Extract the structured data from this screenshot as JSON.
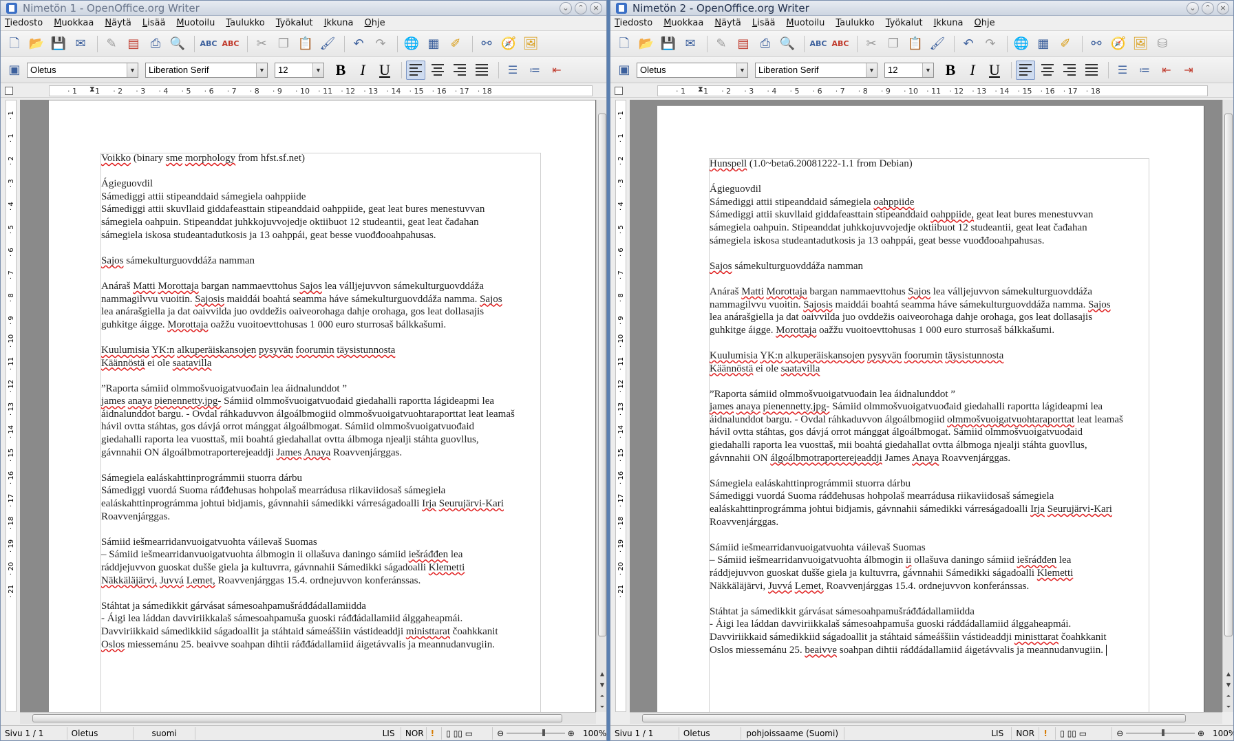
{
  "menu": [
    "Tiedosto",
    "Muokkaa",
    "Näytä",
    "Lisää",
    "Muotoilu",
    "Taulukko",
    "Työkalut",
    "Ikkuna",
    "Ohje"
  ],
  "format": {
    "style": "Oletus",
    "font": "Liberation Serif",
    "size": "12"
  },
  "icons": [
    "new-icon",
    "open-folder-icon",
    "save-icon",
    "email-icon",
    "edit-file-icon",
    "export-pdf-icon",
    "print-icon",
    "print-preview-icon",
    "spellcheck-icon",
    "autospell-icon",
    "cut-icon",
    "copy-icon",
    "paste-icon",
    "format-paintbrush-icon",
    "undo-icon",
    "redo-icon",
    "hyperlink-icon",
    "table-icon",
    "draw-functions-icon",
    "find-binoculars-icon",
    "navigator-icon",
    "gallery-icon",
    "datasources-icon"
  ],
  "ruler_ticks": [
    "1",
    "1",
    "2",
    "3",
    "4",
    "5",
    "6",
    "7",
    "8",
    "9",
    "10",
    "11",
    "12",
    "13",
    "14",
    "15",
    "16",
    "17",
    "18"
  ],
  "vruler_ticks": [
    "1",
    "1",
    "2",
    "3",
    "4",
    "5",
    "6",
    "7",
    "8",
    "9",
    "10",
    "11",
    "12",
    "13",
    "14",
    "15",
    "16",
    "17",
    "18",
    "19",
    "20",
    "21"
  ],
  "window1": {
    "title": "Nimetön 1 - OpenOffice.org Writer",
    "doc": [
      "Voikko (binary sme morphology from hfst.sf.net)",
      "",
      "Ágieguovdil",
      "Sámediggi attii stipeanddaid sámegiela oahppiide",
      "Sámediggi attii skuvllaid giddafeasttain stipeanddaid oahppiide, geat leat bures menestuvvan",
      "sámegiela oahpuin. Stipeanddat juhkkojuvvojedje oktiibuot 12 studeantii, geat leat čađahan",
      "sámegiela iskosa studeantadutkosis ja 13 oahppái, geat besse vuođđooahpahusas.",
      "",
      "Sajos sámekulturguovddáža namman",
      "",
      "Anáraš Matti Morottaja bargan nammaevttohus Sajos lea válljejuvvon sámekulturguovddáža",
      "nammagilvvu vuoitin. Sajosis maiddái boahtá seamma háve sámekulturguovddáža namma. Sajos",
      "lea anárašgiella ja dat oaivvilda juo ovddežis oaiveorohaga dahje orohaga, gos leat dollasajis",
      "guhkitge áigge. Morottaja oažžu vuoitoevttohusas 1 000 euro sturrosaš bálkkašumi.",
      "",
      "Kuulumisia YK:n alkuperäiskansojen pysyvän foorumin täysistunnosta",
      "Käännöstä ei ole saatavilla",
      "",
      "”Raporta sámiid olmmošvuoigatvuođain lea áidnalunddot ”",
      "james anaya pienennetty.jpg- Sámiid olmmošvuoigatvuođaid giedahalli raportta lágideapmi lea",
      "áidnalunddot bargu. - Ovdal ráhkaduvvon álgoálbmogiid olmmošvuoigatvuohtaraporttat leat leamaš",
      "hávil ovtta stáhtas, gos dávjá orrot mánggat álgoálbmogat. Sámiid olmmošvuoigatvuođaid",
      "giedahalli raporta lea vuosttaš, mii boahtá giedahallat ovtta álbmoga njealji stáhta guovllus,",
      "gávnnahii ON álgoálbmotraporterejeaddji James Anaya Roavvenjárggas.",
      "",
      "Sámegiela ealáskahttinprográmmii stuorra dárbu",
      "Sámediggi vuordá Suoma ráđđehusas hohpolaš mearrádusa riikaviidosaš sámegiela",
      "ealáskahttinprográmma johtui bidjamis, gávnnahii sámedikki várreságadoalli Irja Seurujärvi-Kari",
      "Roavvenjárggas.",
      "",
      "Sámiid iešmearridanvuoigatvuohta váilevaš Suomas",
      "– Sámiid iešmearridanvuoigatvuohta álbmogin ii ollašuva daningo sámiid iešráđđen lea",
      "ráddjejuvvon guoskat duššе giela ja kultuvrra, gávnnahii Sámedikki ságadoalli Klemetti",
      "Näkkäläjärvi, Juvvá Lemet, Roavvenjárggas 15.4. ordnejuvvon konferánssas.",
      "",
      "Stáhtat ja sámedikkit gárvásat sámesoahpamušráđđádallamiidda",
      "- Áigi lea láddan davviriikkalaš sámesoahpamuša guoski ráđđádallamiid álggaheapmái.",
      "Davviriikkaid sámedikkiid ságadoallit ja stáhtaid sámeáššiin vástideaddji ministtarat čoahkkanit",
      "Oslos miessemánu 25. beaivve soahpan dihtii ráđđádallamiid áigetávvalis ja meannudanvugiin."
    ],
    "status": {
      "page": "Sivu 1 / 1",
      "style": "Oletus",
      "lang": "suomi",
      "ins": "LIS",
      "sel": "NOR",
      "zoom": "100%"
    }
  },
  "window2": {
    "title": "Nimetön 2 - OpenOffice.org Writer",
    "doc": [
      "Hunspell (1.0~beta6.20081222-1.1 from Debian)",
      "",
      "Ágieguovdil",
      "Sámediggi attii stipeanddaid sámegiela oahppiide",
      "Sámediggi attii skuvllaid giddafeasttain stipeanddaid oahppiide, geat leat bures menestuvvan",
      "sámegiela oahpuin. Stipeanddat juhkkojuvvojedje oktiibuot 12 studeantii, geat leat čađahan",
      "sámegiela iskosa studeantadutkosis ja 13 oahppái, geat besse vuođđooahpahusas.",
      "",
      "Sajos sámekulturguovddáža namman",
      "",
      "Anáraš Matti Morottaja bargan nammaevttohus Sajos lea válljejuvvon sámekulturguovddáža",
      "nammagilvvu vuoitin. Sajosis maiddái boahtá seamma háve sámekulturguovddáža namma. Sajos",
      "lea anárašgiella ja dat oaivvilda juo ovddežis oaiveorohaga dahje orohaga, gos leat dollasajis",
      "guhkitge áigge. Morottaja oažžu vuoitoevttohusas 1 000 euro sturrosaš bálkkašumi.",
      "",
      "Kuulumisia YK:n alkuperäiskansojen pysyvän foorumin täysistunnosta",
      "Käännöstä ei ole saatavilla",
      "",
      "”Raporta sámiid olmmošvuoigatvuođain lea áidnalunddot ”",
      "james anaya pienennetty.jpg- Sámiid olmmošvuoigatvuođaid giedahalli raportta lágideapmi lea",
      "áidnalunddot bargu. - Ovdal ráhkaduvvon álgoálbmogiid olmmošvuoigatvuohtaraporttat leat leamaš",
      "hávil ovtta stáhtas, gos dávjá orrot mánggat álgoálbmogat. Sámiid olmmošvuoigatvuođaid",
      "giedahalli raporta lea vuosttaš, mii boahtá giedahallat ovtta álbmoga njealji stáhta guovllus,",
      "gávnnahii ON álgoálbmotraporterejeaddji James Anaya Roavvenjárggas.",
      "",
      "Sámegiela ealáskahttinprográmmii stuorra dárbu",
      "Sámediggi vuordá Suoma ráđđehusas hohpolaš mearrádusa riikaviidosaš sámegiela",
      "ealáskahttinprográmma johtui bidjamis, gávnnahii sámedikki várreságadoalli Irja Seurujärvi-Kari",
      "Roavvenjárggas.",
      "",
      "Sámiid iešmearridanvuoigatvuohta váilevaš Suomas",
      "– Sámiid iešmearridanvuoigatvuohta álbmogin ii ollašuva daningo sámiid iešráđđen lea",
      "ráddjejuvvon guoskat duššе giela ja kultuvrra, gávnnahii Sámedikki ságadoalli Klemetti",
      "Näkkäläjärvi, Juvvá Lemet, Roavvenjárggas 15.4. ordnejuvvon konferánssas.",
      "",
      "Stáhtat ja sámedikkit gárvásat sámesoahpamušráđđádallamiidda",
      "- Áigi lea láddan davviriikkalaš sámesoahpamuša guoski ráđđádallamiid álggaheapmái.",
      "Davviriikkaid sámedikkiid ságadoallit ja stáhtaid sámeáššiin vástideaddji ministtarat čoahkkanit",
      "Oslos miessemánu 25. beaivve soahpan dihtii ráđđádallamiid áigetávvalis ja meannudanvugiin."
    ],
    "status": {
      "page": "Sivu 1 / 1",
      "style": "Oletus",
      "lang": "pohjoissaame (Suomi)",
      "ins": "LIS",
      "sel": "NOR",
      "zoom": "100%"
    }
  }
}
